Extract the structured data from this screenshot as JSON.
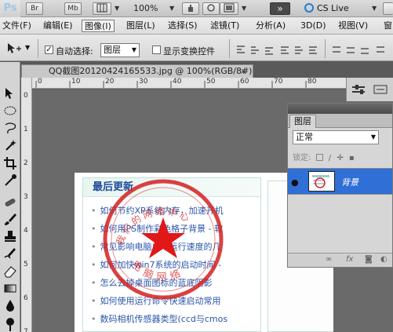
{
  "app": {
    "logo": "Ps",
    "br_label": "Br",
    "mb_label": "Mb",
    "zoom_label": "100%",
    "cs_live_label": "CS Live"
  },
  "menu": [
    "文件(F)",
    "编辑(E)",
    "图像(I)",
    "图层(L)",
    "选择(S)",
    "滤镜(T)",
    "分析(A)",
    "3D(D)",
    "视图(V)",
    "窗口"
  ],
  "menu_active_index": 2,
  "options": {
    "auto_select_label": "自动选择:",
    "auto_select_checked": true,
    "auto_select_value": "图层",
    "show_transform_label": "显示变换控件",
    "show_transform_checked": false
  },
  "document": {
    "tab_title": "QQ截图20120424165533.jpg @ 100%(RGB/8#) *",
    "close_glyph": "×"
  },
  "ruler": {
    "top_numbers": [
      "0",
      "10",
      "20",
      "30",
      "40",
      "50",
      "60",
      "70",
      "80"
    ],
    "left_numbers": [
      "0",
      "1",
      "2",
      "3",
      "4",
      "5",
      "6",
      "7"
    ]
  },
  "webpage": {
    "heading": "最后更新",
    "items": [
      "如何节约XP系统内存，加速开机",
      "如何用PS制作彩色格子背景 - 软",
      "常见影响电脑启动运行速度的几",
      "如何加快win7系统的启动时间 -",
      "怎么去掉桌面图标的蓝底阴影",
      "如何使用运行命令快速启动常用",
      "数码相机传感器类型(ccd与cmos"
    ],
    "stamp_text_top": "我们的网络中心",
    "stamp_text_bottom": "电脑网络"
  },
  "layers_panel": {
    "tab_label": "图层",
    "blend_mode": "正常",
    "lock_label": "锁定:",
    "layer_name": "背景"
  },
  "colors": {
    "accent": "#2f6fd6",
    "stamp": "#d42020",
    "link": "#2a55aa"
  }
}
